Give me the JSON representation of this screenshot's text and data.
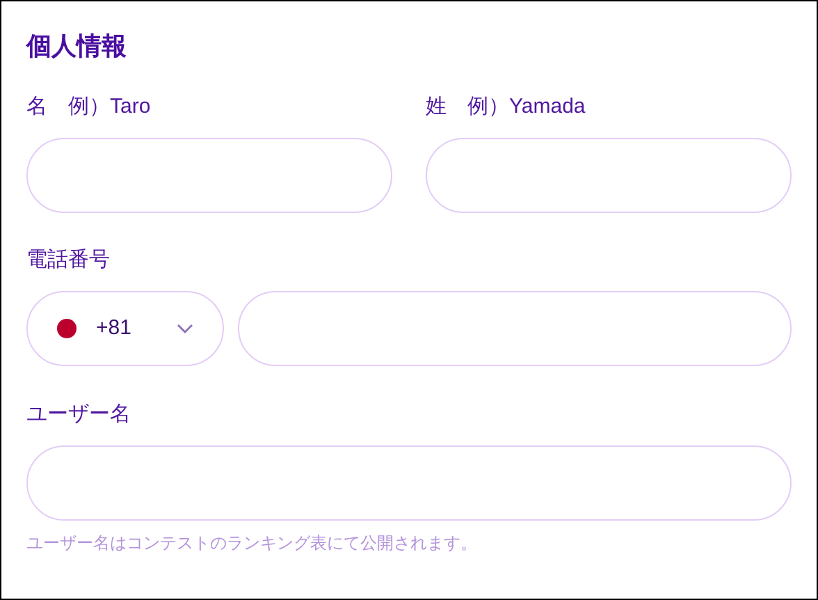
{
  "section": {
    "title": "個人情報"
  },
  "fields": [
    {
      "label": "名　例）Taro"
    },
    {
      "label": "姓　例）Yamada"
    }
  ],
  "phone": {
    "label": "電話番号",
    "country_code": "+81"
  },
  "username": {
    "label": "ユーザー名",
    "help": "ユーザー名はコンテストのランキング表にて公開されます。"
  }
}
